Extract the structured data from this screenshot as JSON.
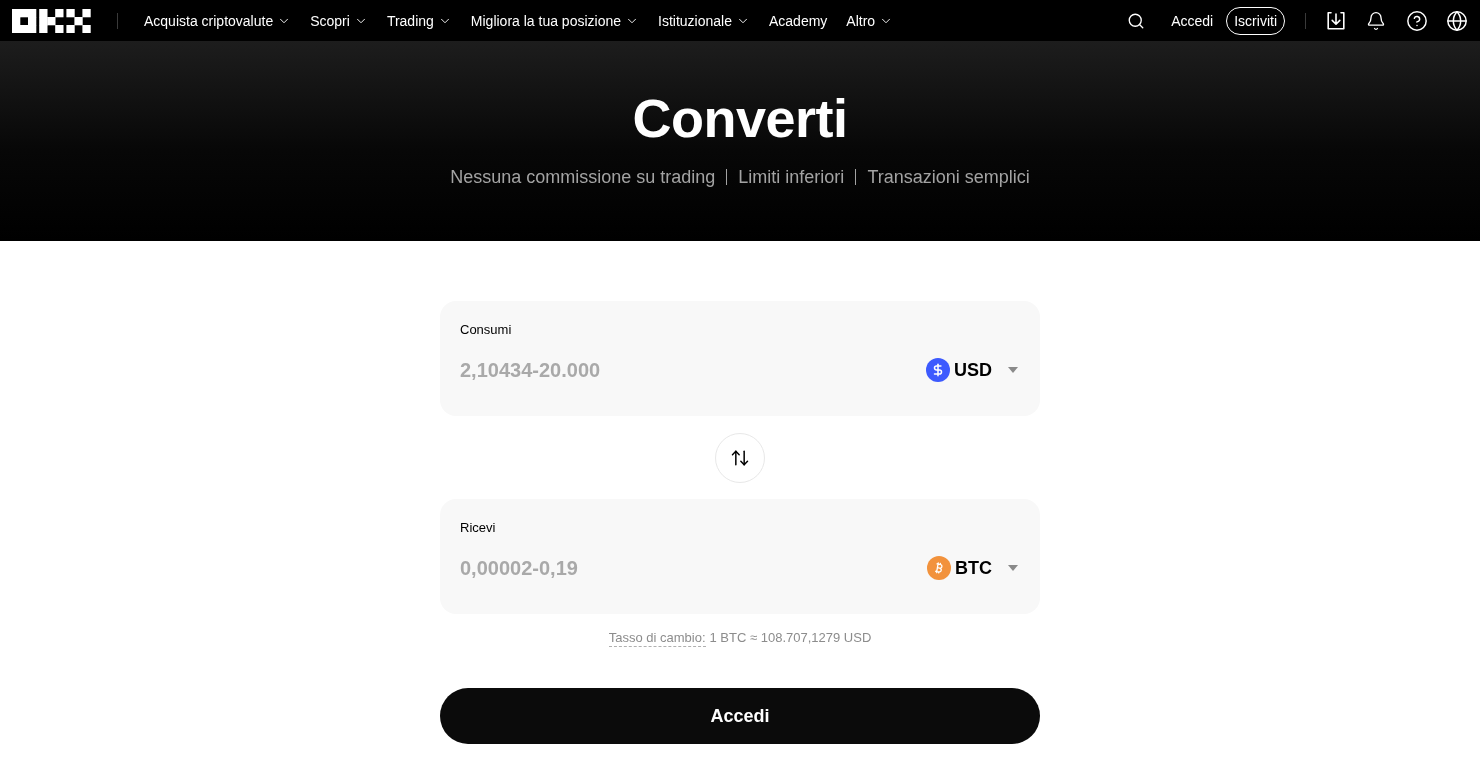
{
  "nav": {
    "items": [
      {
        "label": "Acquista criptovalute",
        "has_menu": true
      },
      {
        "label": "Scopri",
        "has_menu": true
      },
      {
        "label": "Trading",
        "has_menu": true
      },
      {
        "label": "Migliora la tua posizione",
        "has_menu": true
      },
      {
        "label": "Istituzionale",
        "has_menu": true
      },
      {
        "label": "Academy",
        "has_menu": false
      },
      {
        "label": "Altro",
        "has_menu": true
      }
    ],
    "login": "Accedi",
    "signup": "Iscriviti"
  },
  "hero": {
    "title": "Converti",
    "features": [
      "Nessuna commissione su trading",
      "Limiti inferiori",
      "Transazioni semplici"
    ]
  },
  "converter": {
    "fields": [
      {
        "label": "Consumi",
        "placeholder": "2,10434-20.000",
        "currency": "USD",
        "coin": {
          "kind": "dollar",
          "color": "#3d5afe"
        }
      },
      {
        "label": "Ricevi",
        "placeholder": "0,00002-0,19",
        "currency": "BTC",
        "coin": {
          "kind": "bitcoin",
          "color": "#f2923c"
        }
      }
    ],
    "rate": {
      "label": "Tasso di cambio:",
      "value": "1 BTC ≈ 108.707,1279 USD"
    },
    "submit": "Accedi"
  }
}
